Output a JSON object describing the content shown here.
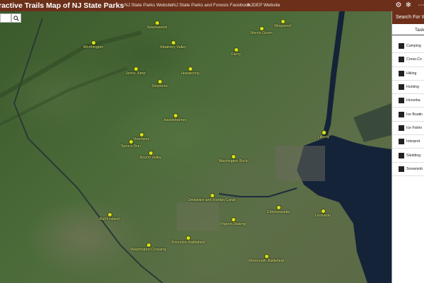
{
  "header": {
    "title": "ractive Trails Map of NJ State Parks",
    "links": [
      "NJ State Parks Website",
      "NJ State Parks and Forests Facebook",
      "NJDEP Website"
    ],
    "icons": [
      "gear-icon",
      "snowflake-icon",
      "more-icon"
    ]
  },
  "map": {
    "parks": [
      {
        "name": "Swartswood"
      },
      {
        "name": "Hacklebarney"
      },
      {
        "name": "Norvin Green"
      },
      {
        "name": "Worthington"
      },
      {
        "name": "Kittatinny Valley"
      },
      {
        "name": "Farny"
      },
      {
        "name": "Jenny Jump"
      },
      {
        "name": "Hopatcong"
      },
      {
        "name": "Stephens"
      },
      {
        "name": "Ringwood"
      },
      {
        "name": "Liberty"
      },
      {
        "name": "Voorhees"
      },
      {
        "name": "Spruce Run"
      },
      {
        "name": "Round Valley"
      },
      {
        "name": "Washington Rock"
      },
      {
        "name": "Delaware and Raritan Canal"
      },
      {
        "name": "Cheesequake"
      },
      {
        "name": "Bull's Island"
      },
      {
        "name": "Leonardo"
      },
      {
        "name": "Pigeon Swamp"
      },
      {
        "name": "Princeton Battlefield"
      },
      {
        "name": "Washington Crossing"
      },
      {
        "name": "Monmouth Battlefield"
      }
    ]
  },
  "panel": {
    "title": "Search For W",
    "subtitle": "Task",
    "activities": [
      "Camping",
      "Cross-Co",
      "Hiking",
      "Hunting",
      "Horseba",
      "Ice Boatin",
      "Ice Fishin",
      "Interpret",
      "Sledding",
      "Snowmob"
    ]
  }
}
